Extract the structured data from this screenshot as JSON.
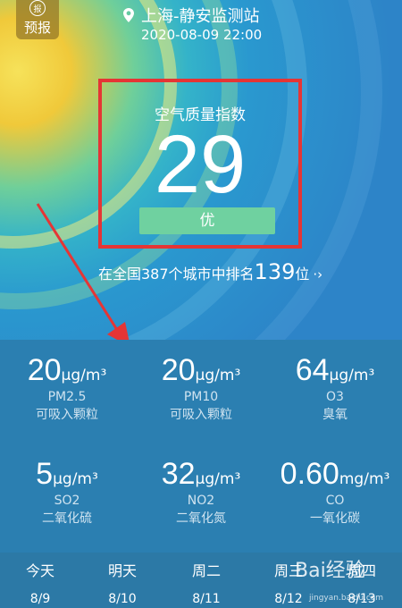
{
  "header": {
    "forecast_badge": "报",
    "forecast_label": "预报",
    "station": "上海-静安监测站",
    "datetime": "2020-08-09 22:00"
  },
  "aqi": {
    "label": "空气质量指数",
    "value": "29",
    "level": "优"
  },
  "rank": {
    "prefix": "在全国387个城市中排名",
    "position": "139",
    "suffix": "位",
    "arrow": "·›"
  },
  "pollutants": [
    {
      "value": "20",
      "unit": "μg/m³",
      "name": "PM2.5",
      "cn": "可吸入颗粒"
    },
    {
      "value": "20",
      "unit": "μg/m³",
      "name": "PM10",
      "cn": "可吸入颗粒"
    },
    {
      "value": "64",
      "unit": "μg/m³",
      "name": "O3",
      "cn": "臭氧"
    },
    {
      "value": "5",
      "unit": "μg/m³",
      "name": "SO2",
      "cn": "二氧化硫"
    },
    {
      "value": "32",
      "unit": "μg/m³",
      "name": "NO2",
      "cn": "二氧化氮"
    },
    {
      "value": "0.60",
      "unit": "mg/m³",
      "name": "CO",
      "cn": "一氧化碳"
    }
  ],
  "forecast_days": [
    {
      "label": "今天",
      "date": "8/9"
    },
    {
      "label": "明天",
      "date": "8/10"
    },
    {
      "label": "周二",
      "date": "8/11"
    },
    {
      "label": "周三",
      "date": "8/12"
    },
    {
      "label": "周四",
      "date": "8/13"
    }
  ],
  "watermark": {
    "text": "Bai经验",
    "url": "jingyan.baidu.com"
  },
  "colors": {
    "highlight_border": "#e53535",
    "level_good": "#6fd1a0",
    "arrow": "#e53535"
  }
}
